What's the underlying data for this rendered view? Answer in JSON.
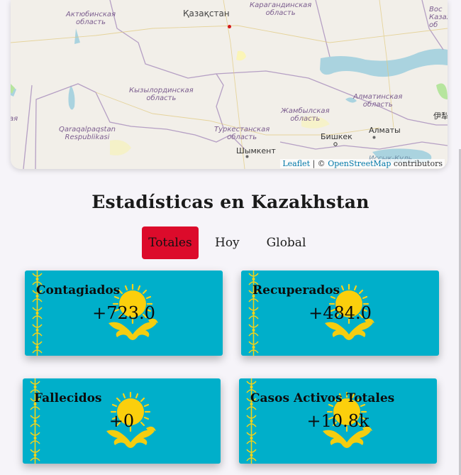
{
  "map": {
    "labels": {
      "aktobe": "Актюбинская\nобласть",
      "kazakhstan": "Қазақстан",
      "karaganda": "Карагандинская\nобласть",
      "vko": "Вос\nКазах\nоб",
      "kyzylorda": "Кызылординская\nобласть",
      "zhambyl": "Жамбылская\nобласть",
      "almaty_obl": "Алматинская\nобласть",
      "karakalpak": "Qaraqalpaqstan\nRespublikasi",
      "turkestan": "Туркестанская\nобласть",
      "bishkek": "Бишкек",
      "almaty": "Алматы",
      "shymkent": "Шымкент",
      "ili": "伊犁",
      "left_edge": "ая",
      "issyk": "Иссык-Куль"
    },
    "attribution": {
      "leaflet": "Leaflet",
      "sep": "| ©",
      "osm": "OpenStreetMap",
      "contrib": "contributors"
    }
  },
  "page": {
    "title": "Estadísticas en Kazakhstan"
  },
  "tabs": [
    {
      "label": "Totales",
      "active": true
    },
    {
      "label": "Hoy",
      "active": false
    },
    {
      "label": "Global",
      "active": false
    }
  ],
  "cards": [
    {
      "label": "Contagiados",
      "value": "+723.0"
    },
    {
      "label": "Recuperados",
      "value": "+484.0"
    },
    {
      "label": "Fallecidos",
      "value": "+0"
    },
    {
      "label": "Casos Activos Totales",
      "value": "+10.8k"
    }
  ],
  "colors": {
    "flag_blue": "#00afca",
    "flag_gold": "#fcd20f",
    "accent_red": "#dc0b2b",
    "map_land": "#f2efe9",
    "map_water": "#aad3df"
  },
  "icons": {
    "marker": "location-dot-icon",
    "emblem": "sun-eagle-emblem-icon",
    "pattern": "ornament-pattern-icon"
  }
}
